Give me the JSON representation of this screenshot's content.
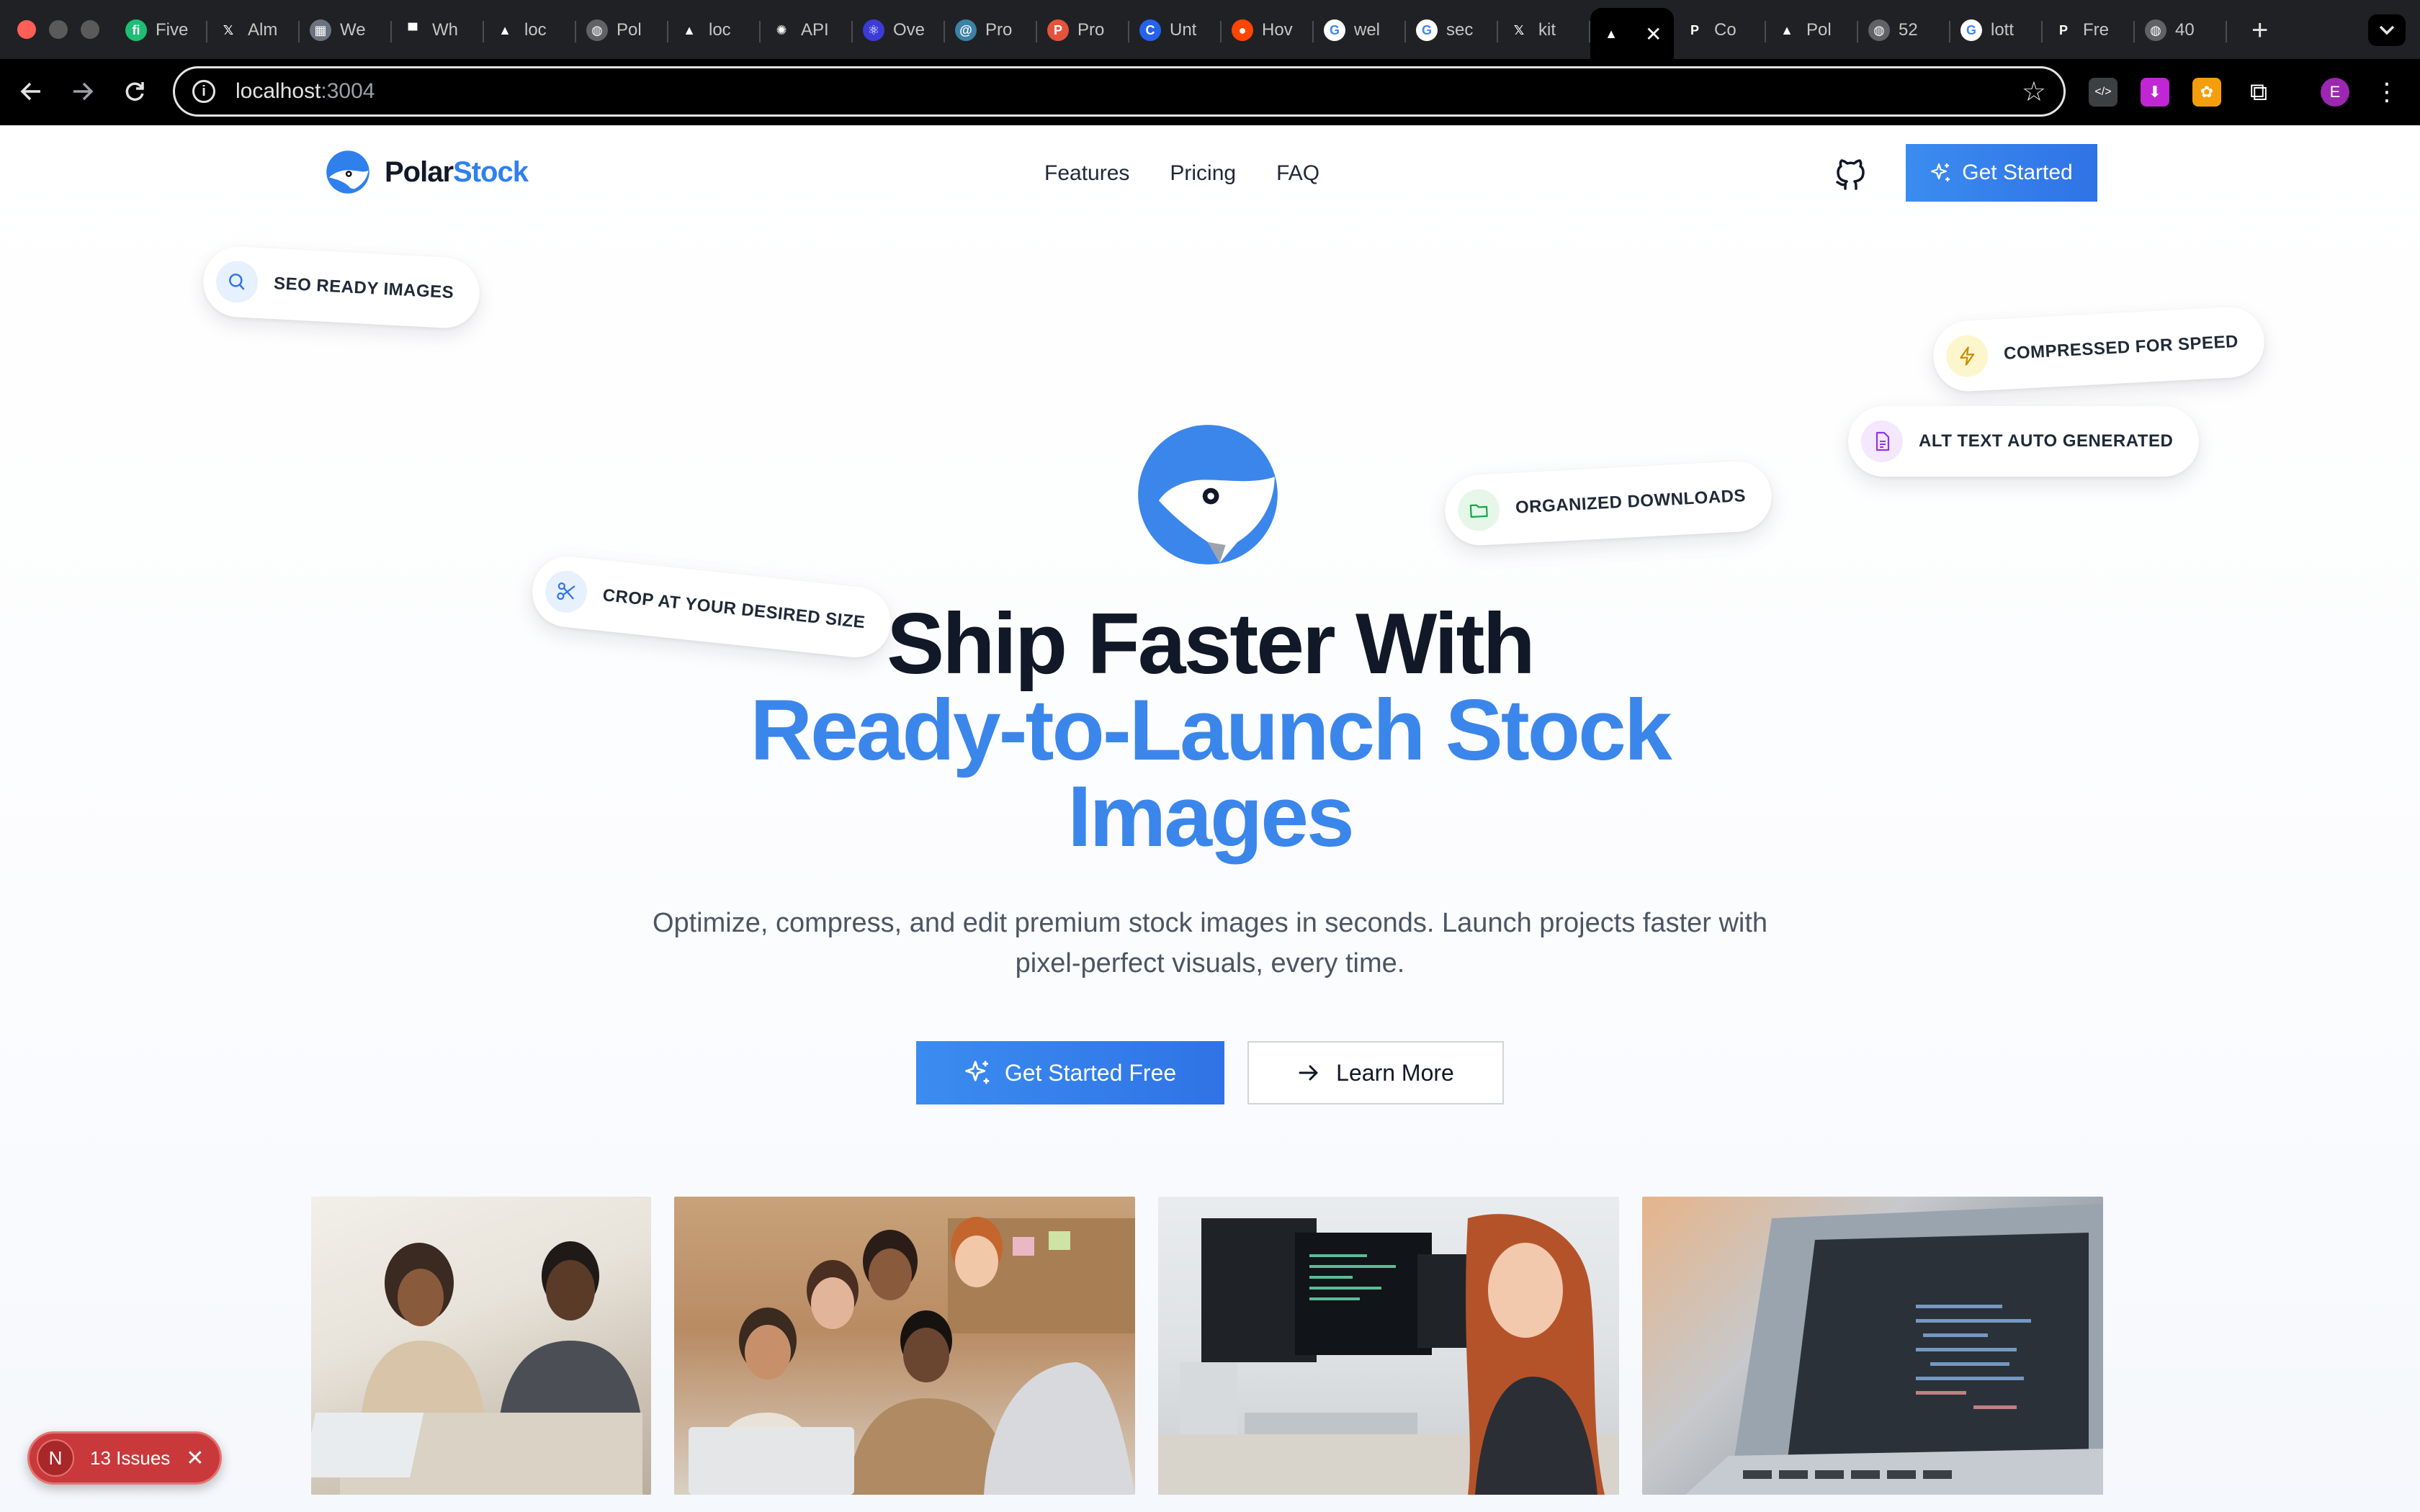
{
  "browser": {
    "tabs": [
      {
        "title": "Five",
        "favicon": "fiverr-icon",
        "color": "#1dbf73"
      },
      {
        "title": "Alm",
        "favicon": "x-icon",
        "color": "#000000"
      },
      {
        "title": "We",
        "favicon": "pattern-icon",
        "color": "#6b7280"
      },
      {
        "title": "Wh",
        "favicon": "block-icon",
        "color": "#111111"
      },
      {
        "title": "loc",
        "favicon": "triangle-icon",
        "color": "#111111"
      },
      {
        "title": "Pol",
        "favicon": "globe-icon",
        "color": "#5f6368"
      },
      {
        "title": "loc",
        "favicon": "triangle-icon",
        "color": "#111111"
      },
      {
        "title": "API",
        "favicon": "openai-icon",
        "color": "#111111"
      },
      {
        "title": "Ove",
        "favicon": "react-icon",
        "color": "#3b3bd6"
      },
      {
        "title": "Pro",
        "favicon": "spiral-icon",
        "color": "#3b82a6"
      },
      {
        "title": "Pro",
        "favicon": "p-icon",
        "color": "#e5533d"
      },
      {
        "title": "Unt",
        "favicon": "c-icon",
        "color": "#2563eb"
      },
      {
        "title": "Hov",
        "favicon": "reddit-icon",
        "color": "#ff4500"
      },
      {
        "title": "wel",
        "favicon": "google-icon",
        "color": "#ffffff"
      },
      {
        "title": "sec",
        "favicon": "google-icon",
        "color": "#ffffff"
      },
      {
        "title": "kit",
        "favicon": "x-icon",
        "color": "#000000"
      },
      {
        "title": "",
        "favicon": "triangle-icon",
        "color": "#000000",
        "active": true
      },
      {
        "title": "Co",
        "favicon": "polar-p-icon",
        "color": "#111111"
      },
      {
        "title": "Pol",
        "favicon": "triangle-icon",
        "color": "#111111"
      },
      {
        "title": "52",
        "favicon": "globe-icon",
        "color": "#5f6368"
      },
      {
        "title": "lott",
        "favicon": "google-icon",
        "color": "#ffffff"
      },
      {
        "title": "Fre",
        "favicon": "polar-p-icon",
        "color": "#111111"
      },
      {
        "title": "40",
        "favicon": "globe-icon",
        "color": "#5f6368"
      }
    ],
    "url_host": "localhost",
    "url_port": ":3004"
  },
  "nav": {
    "brand_part1": "Polar",
    "brand_part2": "Stock",
    "links": [
      "Features",
      "Pricing",
      "FAQ"
    ],
    "cta": "Get Started"
  },
  "pills": {
    "seo": "SEO READY IMAGES",
    "compressed": "COMPRESSED FOR SPEED",
    "alt_text": "ALT TEXT AUTO GENERATED",
    "organized": "ORGANIZED DOWNLOADS",
    "crop": "CROP AT YOUR DESIRED SIZE"
  },
  "hero": {
    "title_line1": "Ship Faster With",
    "title_line2": "Ready-to-Launch Stock",
    "title_line3": "Images",
    "subtitle": "Optimize, compress, and edit premium stock images in seconds. Launch projects faster with pixel-perfect visuals, every time.",
    "primary_cta": "Get Started Free",
    "secondary_cta": "Learn More"
  },
  "gallery": [
    {
      "alt": "team-meeting-photo"
    },
    {
      "alt": "group-laptop-photo"
    },
    {
      "alt": "developer-monitors-photo"
    },
    {
      "alt": "laptop-code-photo"
    }
  ],
  "devtools": {
    "badge_letter": "N",
    "issues_label": "13 Issues"
  },
  "colors": {
    "brand_blue": "#2f80ed",
    "title_dark": "#111827",
    "issues_red": "#c9393b"
  }
}
